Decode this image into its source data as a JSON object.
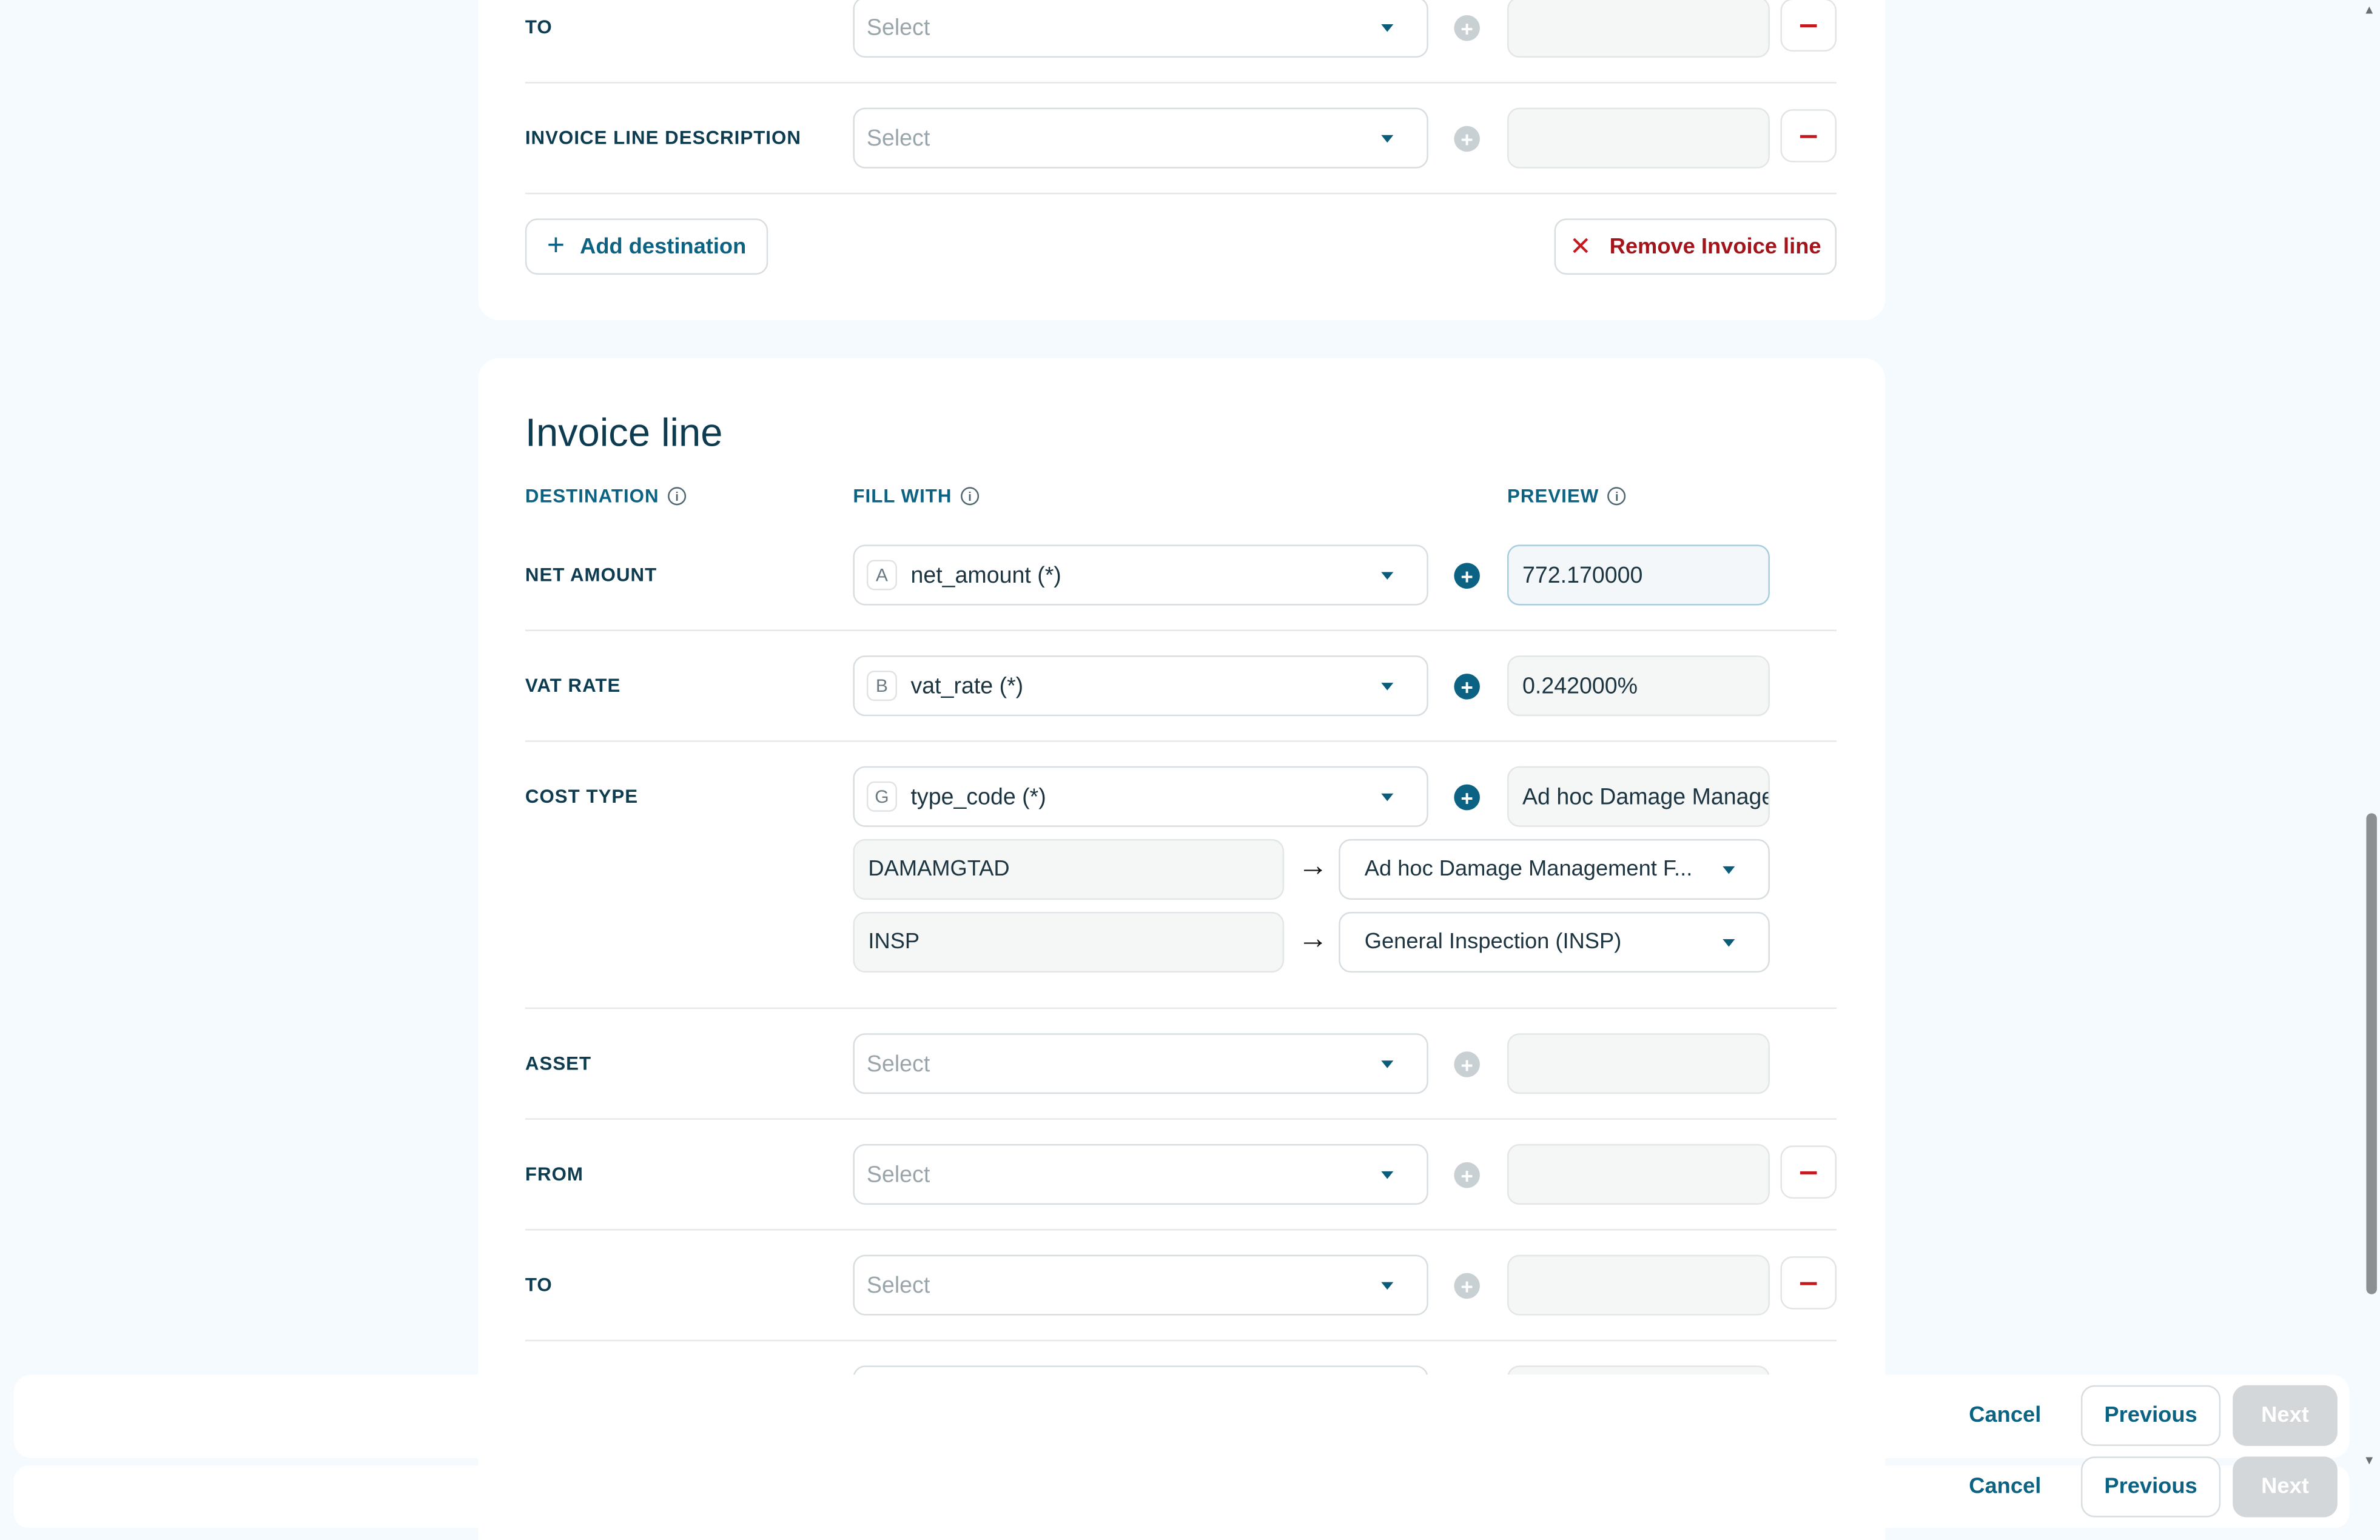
{
  "top_section": {
    "rows": [
      {
        "label": "TO",
        "placeholder": "Select"
      },
      {
        "label": "INVOICE LINE DESCRIPTION",
        "placeholder": "Select"
      }
    ],
    "add_destination_label": "Add destination",
    "remove_invoice_line_label": "Remove Invoice line"
  },
  "invoice_line": {
    "title": "Invoice line",
    "columns": {
      "destination": "DESTINATION",
      "fill_with": "FILL WITH",
      "preview": "PREVIEW"
    },
    "rows": [
      {
        "label": "NET AMOUNT",
        "letter": "A",
        "value": "net_amount (*)",
        "preview": "772.170000"
      },
      {
        "label": "VAT RATE",
        "letter": "B",
        "value": "vat_rate (*)",
        "preview": "0.242000%"
      },
      {
        "label": "COST TYPE",
        "letter": "G",
        "value": "type_code (*)",
        "preview": "Ad hoc Damage Management F"
      },
      {
        "label": "ASSET",
        "placeholder": "Select"
      },
      {
        "label": "FROM",
        "placeholder": "Select"
      },
      {
        "label": "TO",
        "placeholder": "Select"
      }
    ],
    "mappings": [
      {
        "source": "DAMAMGTAD",
        "target": "Ad hoc Damage Management F..."
      },
      {
        "source": "INSP",
        "target": "General Inspection (INSP)"
      }
    ]
  },
  "footer": {
    "cancel": "Cancel",
    "previous": "Previous",
    "next": "Next"
  },
  "colors": {
    "primary": "#0b6282",
    "danger": "#c4191f",
    "background": "#f4fafd",
    "disabled_button": "#d4d7d9"
  }
}
